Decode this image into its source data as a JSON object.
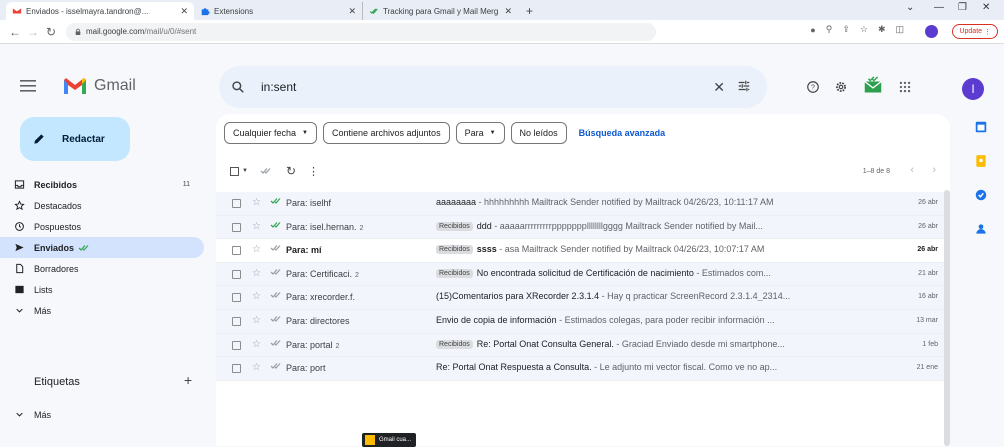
{
  "browser": {
    "tabs": [
      {
        "title": "Enviados - isselmayra.tandron@...",
        "active": true
      },
      {
        "title": "Extensions",
        "active": false
      },
      {
        "title": "Tracking para Gmail y Mail Merg",
        "active": false
      }
    ],
    "url_host": "mail.google.com",
    "url_path": "/mail/u/0/#sent",
    "update_label": "Update"
  },
  "gmail": {
    "logo_text": "Gmail",
    "search_query": "in:sent",
    "avatar_initial": "I",
    "compose_label": "Redactar"
  },
  "sidebar": {
    "items": [
      {
        "label": "Recibidos",
        "count": "11",
        "active": false,
        "bold": true
      },
      {
        "label": "Destacados",
        "count": "",
        "active": false,
        "bold": false
      },
      {
        "label": "Pospuestos",
        "count": "",
        "active": false,
        "bold": false
      },
      {
        "label": "Enviados",
        "count": "",
        "active": true,
        "bold": true
      },
      {
        "label": "Borradores",
        "count": "",
        "active": false,
        "bold": false
      },
      {
        "label": "Lists",
        "count": "",
        "active": false,
        "bold": false
      },
      {
        "label": "Más",
        "count": "",
        "active": false,
        "bold": false
      }
    ],
    "labels_title": "Etiquetas",
    "labels_more": "Más"
  },
  "filters": {
    "chips": [
      "Cualquier fecha",
      "Contiene archivos adjuntos",
      "Para",
      "No leídos"
    ],
    "advanced": "Búsqueda avanzada"
  },
  "toolbar": {
    "pager": "1–8 de 8"
  },
  "emails": [
    {
      "sender": "Para: iselhf",
      "thread": "",
      "badge": "",
      "subject": "aaaaaaaa",
      "snippet": " - hhhhhhhhh Mailtrack Sender notified by Mailtrack 04/26/23, 10:11:17 AM",
      "date": "26 abr",
      "unread": false,
      "tracked": "double-green"
    },
    {
      "sender": "Para: isel.hernan.",
      "thread": "2",
      "badge": "Recibidos",
      "subject": "ddd",
      "snippet": " - aaaaarrrrrrrrrpppppppllllllllgggg Mailtrack Sender notified by Mail...",
      "date": "26 abr",
      "unread": false,
      "tracked": "double-green"
    },
    {
      "sender": "Para: mí",
      "thread": "",
      "badge": "Recibidos",
      "subject": "ssss",
      "snippet": " - asa Mailtrack Sender notified by Mailtrack 04/26/23, 10:07:17 AM",
      "date": "26 abr",
      "unread": true,
      "tracked": "double-grey"
    },
    {
      "sender": "Para: Certificaci.",
      "thread": "2",
      "badge": "Recibidos",
      "subject": "No encontrada solicitud de Certificación de nacimiento",
      "snippet": " - Estimados com...",
      "date": "21 abr",
      "unread": false,
      "tracked": "double-grey"
    },
    {
      "sender": "Para: xrecorder.f.",
      "thread": "",
      "badge": "",
      "subject": "(15)Comentarios para XRecorder 2.3.1.4",
      "snippet": " - Hay q practicar ScreenRecord 2.3.1.4_2314...",
      "date": "16 abr",
      "unread": false,
      "tracked": "double-grey"
    },
    {
      "sender": "Para: directores",
      "thread": "",
      "badge": "",
      "subject": "Envio de copia de información",
      "snippet": " - Estimados colegas, para poder recibir información ...",
      "date": "13 mar",
      "unread": false,
      "tracked": "double-grey"
    },
    {
      "sender": "Para: portal",
      "thread": "2",
      "badge": "Recibidos",
      "subject": "Re: Portal Onat Consulta General.",
      "snippet": " - Graciad Enviado desde mi smartphone...",
      "date": "1 feb",
      "unread": false,
      "tracked": "double-grey"
    },
    {
      "sender": "Para: port",
      "thread": "",
      "badge": "",
      "subject": "Re: Portal Onat Respuesta a Consulta.",
      "snippet": " - Le adjunto mi vector fiscal. Como ve no ap...",
      "date": "21 ene",
      "unread": false,
      "tracked": "double-grey"
    }
  ],
  "drag_tooltip": "Gmail cua...",
  "colors": {
    "accent": "#0b57d0",
    "compose": "#c2e7ff",
    "active_nav": "#d3e3fd",
    "track_green": "#34a853"
  }
}
